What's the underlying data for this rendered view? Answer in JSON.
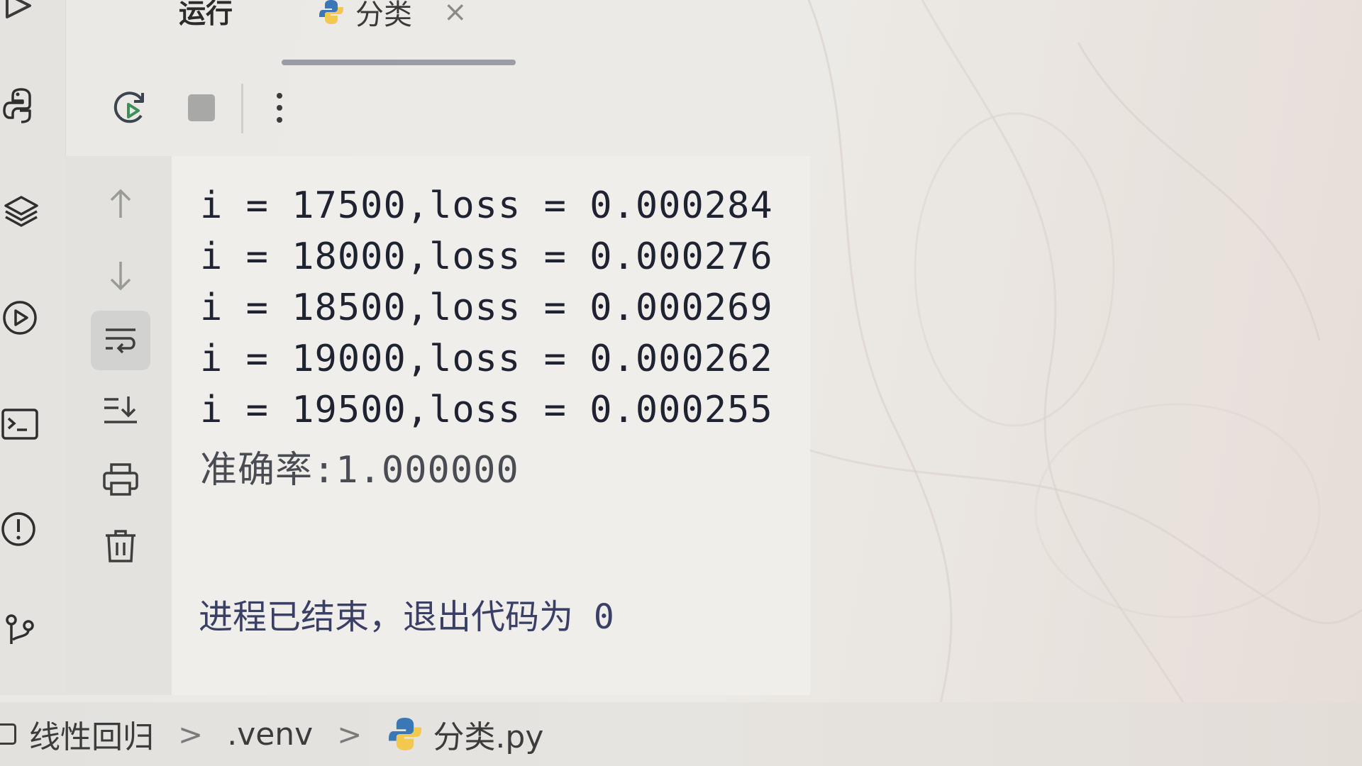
{
  "tabs": {
    "run_label": "运行",
    "active_tab_label": "分类",
    "close_glyph": "×"
  },
  "toolbar": {
    "icons": [
      "rerun-icon",
      "stop-icon",
      "more-options-icon"
    ]
  },
  "side_actions": {
    "icons": [
      "scroll-up-icon",
      "scroll-down-icon",
      "soft-wrap-icon",
      "scroll-to-end-icon",
      "print-icon",
      "clear-icon"
    ]
  },
  "left_tools": {
    "icons": [
      "python-console-icon",
      "layers-icon",
      "run-tool-icon",
      "terminal-icon",
      "problems-icon",
      "git-icon"
    ]
  },
  "console": {
    "lines": [
      "i = 17500,loss = 0.000284",
      "i = 18000,loss = 0.000276",
      "i = 18500,loss = 0.000269",
      "i = 19000,loss = 0.000262",
      "i = 19500,loss = 0.000255",
      "准确率:1.000000"
    ],
    "exit_message": "进程已结束，退出代码为 0"
  },
  "breadcrumb": {
    "project": "线性回归",
    "folder": ".venv",
    "file": "分类.py",
    "separator": ">"
  },
  "colors": {
    "python_blue": "#3b77b6",
    "python_yellow": "#f2c94c",
    "console_text": "#1f2230",
    "exit_text": "#3a3f66"
  }
}
